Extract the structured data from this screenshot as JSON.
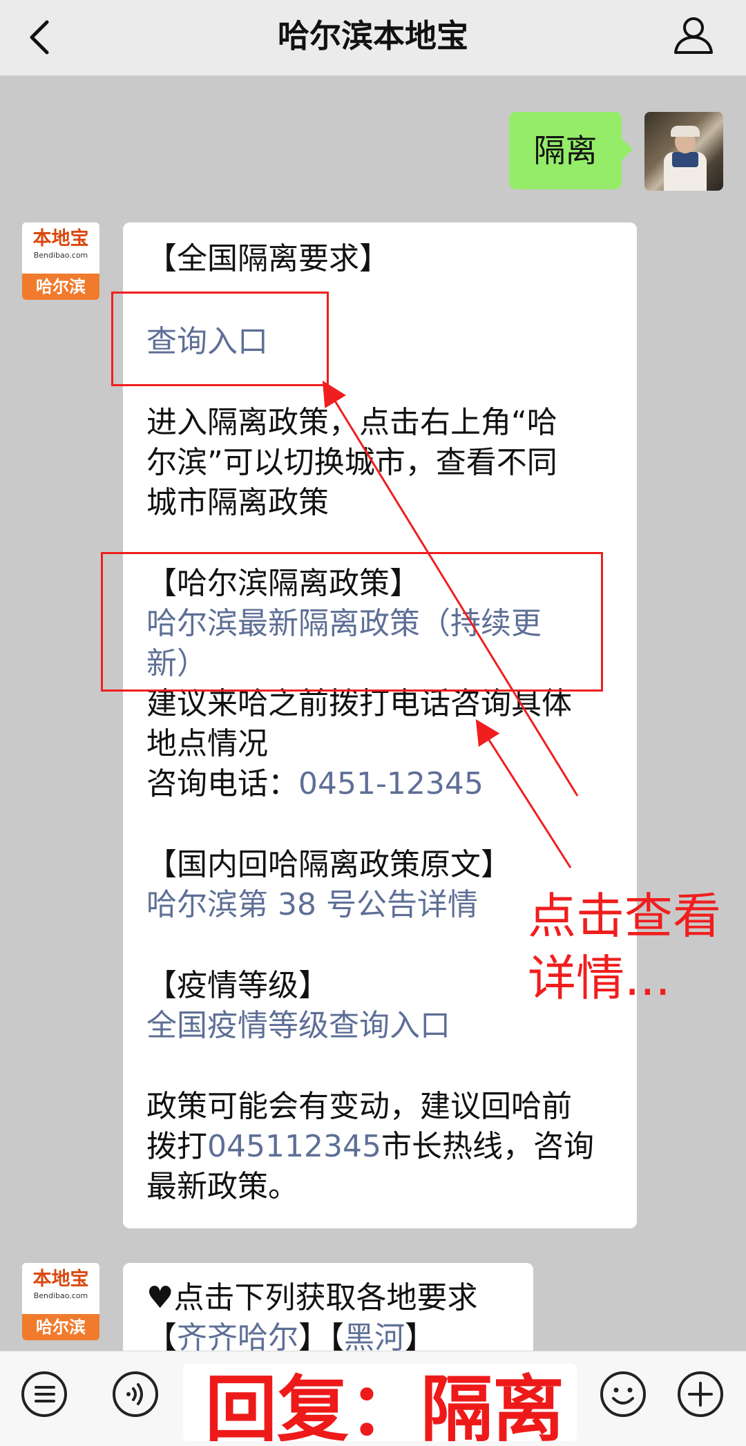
{
  "header": {
    "title": "哈尔滨本地宝",
    "back_icon": "chevron-left-icon",
    "profile_icon": "person-icon"
  },
  "messages": {
    "user_bubble": "隔离",
    "bot_avatar": {
      "brand": "本地宝",
      "domain": "Bendibao.com",
      "city": "哈尔滨"
    },
    "reply1": {
      "heading": "【全国隔离要求】",
      "query_link": "查询入口",
      "instructions": [
        "进入隔离政策，点击右上角“哈",
        "尔滨”可以切换城市，查看不同",
        "城市隔离政策"
      ],
      "harbin_heading": "【哈尔滨隔离政策】",
      "harbin_link": [
        "哈尔滨最新隔离政策（持续更",
        "新）"
      ],
      "advice": [
        "建议来哈之前拨打电话咨询具体",
        "地点情况"
      ],
      "phone_label": "咨询电话：",
      "phone": "0451-12345",
      "domestic_heading": "【国内回哈隔离政策原文】",
      "domestic_link": "哈尔滨第 38 号公告详情",
      "level_heading": "【疫情等级】",
      "level_link": "全国疫情等级查询入口",
      "policy_line1": "政策可能会有变动，建议回哈前",
      "policy_pre": "拨打",
      "policy_hotline": "045112345",
      "policy_post": "市长热线，咨询",
      "policy_line3": "最新政策。"
    },
    "reply2": {
      "line1": "♥点击下列获取各地要求",
      "bracket_open": "【",
      "city1": "齐齐哈尔",
      "bracket_mid": "】【",
      "city2": "黑河",
      "bracket_close": "】"
    }
  },
  "annotation": {
    "hint_lines": [
      "点击查看",
      "详情..."
    ],
    "color": "#f01e1e"
  },
  "input_bar": {
    "reply_hint": "回复：隔离",
    "icons": [
      "list-icon",
      "voice-icon",
      "emoji-icon",
      "plus-icon"
    ]
  }
}
